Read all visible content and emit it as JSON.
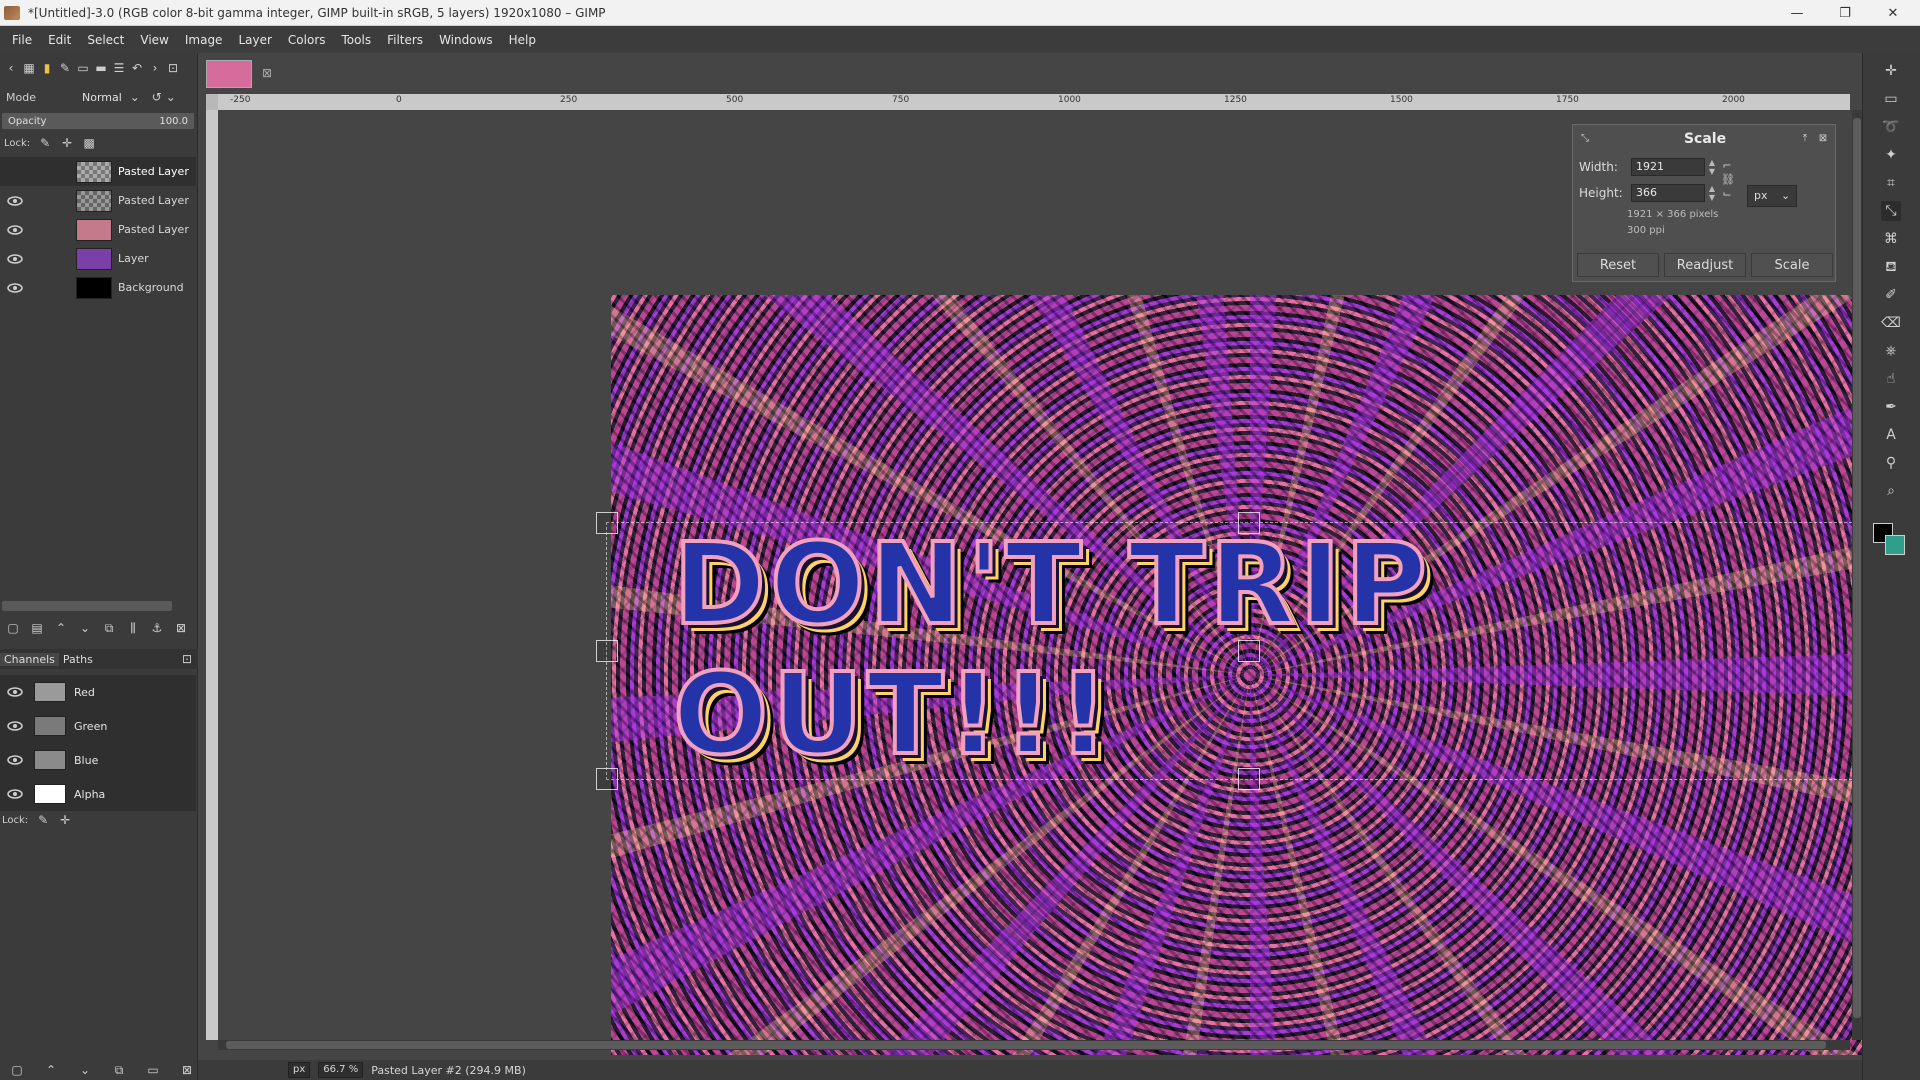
{
  "window": {
    "title": "*[Untitled]-3.0 (RGB color 8-bit gamma integer, GIMP built-in sRGB, 5 layers) 1920x1080 – GIMP",
    "controls": {
      "minimize": "—",
      "maximize": "❐",
      "close": "✕"
    }
  },
  "menu": [
    "File",
    "Edit",
    "Select",
    "View",
    "Image",
    "Layer",
    "Colors",
    "Tools",
    "Filters",
    "Windows",
    "Help"
  ],
  "layers_panel": {
    "mode_label": "Mode",
    "mode_value": "Normal",
    "opacity_label": "Opacity",
    "opacity_value": "100.0",
    "lock_label": "Lock:",
    "layers": [
      {
        "name": "Pasted Layer",
        "visible": false,
        "active": true,
        "thumb": "#9a9a9a"
      },
      {
        "name": "Pasted Layer",
        "visible": true,
        "active": false,
        "thumb": "#8a8a8a"
      },
      {
        "name": "Pasted Layer",
        "visible": true,
        "active": false,
        "thumb": "#c47a88"
      },
      {
        "name": "Layer",
        "visible": true,
        "active": false,
        "thumb": "#7b3fa8"
      },
      {
        "name": "Background",
        "visible": true,
        "active": false,
        "thumb": "#000000"
      }
    ]
  },
  "channels_panel": {
    "tabs": [
      "Channels",
      "Paths"
    ],
    "channels": [
      {
        "name": "Red",
        "thumb": "#9a9a9a"
      },
      {
        "name": "Green",
        "thumb": "#7a7a7a"
      },
      {
        "name": "Blue",
        "thumb": "#8a8a8a"
      },
      {
        "name": "Alpha",
        "thumb": "#ffffff"
      }
    ],
    "lock_label": "Lock:"
  },
  "ruler": {
    "h_labels": [
      "-250",
      "0",
      "250",
      "500",
      "750",
      "1000",
      "1250",
      "1500",
      "1750",
      "2000"
    ]
  },
  "canvas": {
    "headline": "DON'T TRIP OUT!!!"
  },
  "scale_dialog": {
    "title": "Scale",
    "width_label": "Width:",
    "width_value": "1921",
    "height_label": "Height:",
    "height_value": "366",
    "unit": "px",
    "info_size": "1921 × 366 pixels",
    "info_res": "300 ppi",
    "buttons": {
      "reset": "Reset",
      "readjust": "Readjust",
      "scale": "Scale"
    }
  },
  "status": {
    "unit": "px",
    "zoom": "66.7 %",
    "message": "Pasted Layer #2 (294.9 MB)"
  },
  "colors": {
    "foreground": "#000000",
    "background": "#2f9e8a",
    "image_tab": "#d66c9b"
  }
}
